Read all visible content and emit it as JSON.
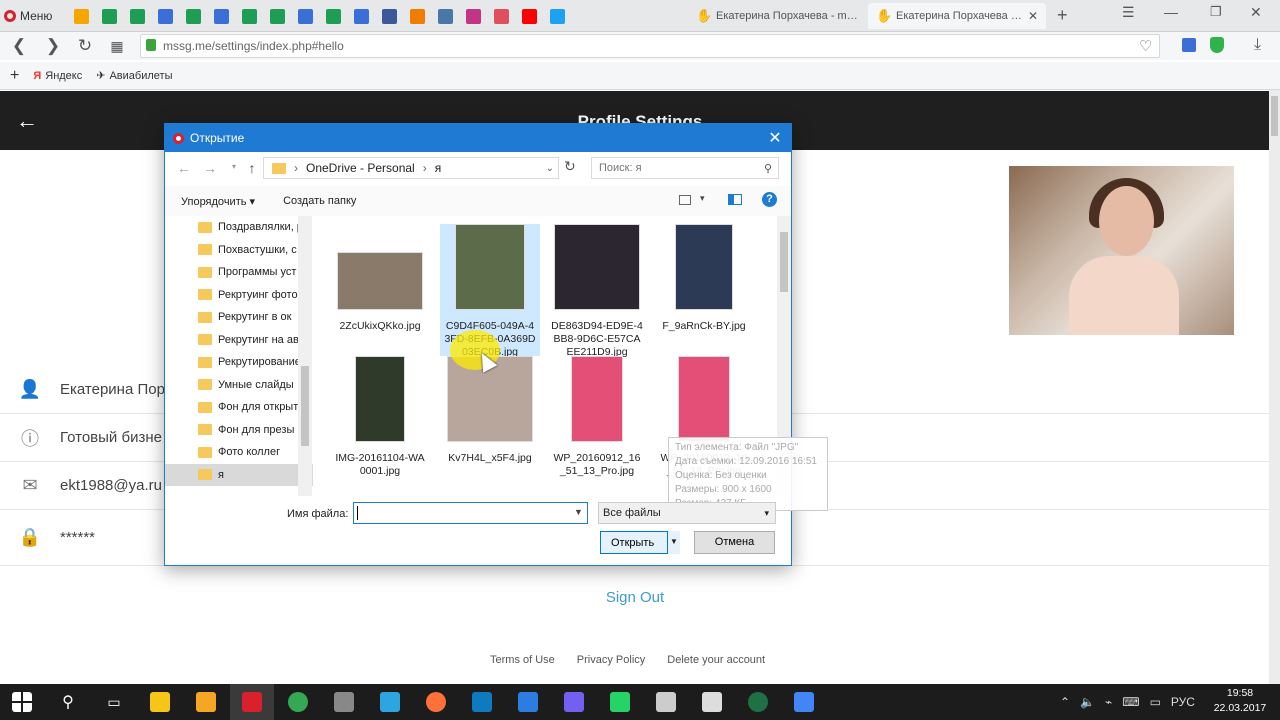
{
  "browser": {
    "menu_label": "Меню",
    "tabs": [
      {
        "label": "Екатерина Порхачева - mssg"
      },
      {
        "label": "Екатерина Порхачева - mssg"
      }
    ],
    "url": "mssg.me/settings/index.php#hello",
    "bookmarks": [
      "Яндекс",
      "Авиабилеты"
    ],
    "pinned_colors": [
      "#f7a600",
      "#1e9e55",
      "#1e9e55",
      "#3b6fd8",
      "#1e9e55",
      "#3b6fd8",
      "#1e9e55",
      "#1e9e55",
      "#3b6fd8",
      "#1e9e55",
      "#3b6fd8",
      "#3b5998",
      "#f07d00",
      "#4a76a8",
      "#c13584",
      "#e04f5f",
      "#ff0000",
      "#1da1f2"
    ]
  },
  "page": {
    "title": "Profile Settings",
    "rows": [
      {
        "icon": "person-icon",
        "text": "Екатерина Пор"
      },
      {
        "icon": "info-icon",
        "text": "Готовый бизне"
      },
      {
        "icon": "mail-icon",
        "text": "ekt1988@ya.ru"
      },
      {
        "icon": "lock-icon",
        "text": "******"
      }
    ],
    "signout": "Sign Out",
    "footer": [
      "Terms of Use",
      "Privacy Policy",
      "Delete your account"
    ]
  },
  "dialog": {
    "title": "Открытие",
    "breadcrumb": [
      "OneDrive - Personal",
      "я"
    ],
    "search_placeholder": "Поиск: я",
    "organize": "Упорядочить",
    "new_folder": "Создать папку",
    "tree": [
      "Поздравлялки, р",
      "Похвастушки, с",
      "Программы уст",
      "Рекртуинг фото",
      "Рекрутинг в ок",
      "Рекрутинг на ав",
      "Рекрутирование",
      "Умные слайды",
      "Фон для открыт",
      "Фон для презы",
      "Фото коллег",
      "я"
    ],
    "files": [
      {
        "name": "2ZcUkixQKko.jpg",
        "color": "#8a7a6a"
      },
      {
        "name": "C9D4F605-049A-43FD-8EFB-0A369D03EC0B.jpg",
        "color": "#5c6b4a"
      },
      {
        "name": "DE863D94-ED9E-4BB8-9D6C-E57CAEE211D9.jpg",
        "color": "#2b2630"
      },
      {
        "name": "F_9aRnCk-BY.jpg",
        "color": "#2d3a55"
      },
      {
        "name": "IMG-20161104-WA0001.jpg",
        "color": "#2f3a2a"
      },
      {
        "name": "Kv7H4L_x5F4.jpg",
        "color": "#b8a59c"
      },
      {
        "name": "WP_20160912_16_51_13_Pro.jpg",
        "color": "#e34f77"
      },
      {
        "name": "WP_20160912_16_51_18_Pro.jpg",
        "color": "#e34f77"
      }
    ],
    "tooltip": [
      "Тип элемента: Файл \"JPG\"",
      "Дата съемки: 12.09.2016 16:51",
      "Оценка: Без оценки",
      "Размеры: 900 x 1600",
      "Размер: 437 КБ"
    ],
    "filename_label": "Имя файла:",
    "filter": "Все файлы",
    "open": "Открыть",
    "cancel": "Отмена"
  },
  "taskbar": {
    "app_colors": [
      "#f5c518",
      "#f5a623",
      "#d8212b",
      "#34a853",
      "#888888",
      "#2ca5e0",
      "#ff7139",
      "#0f7bbf",
      "#2c7de1",
      "#7360f2",
      "#25d366",
      "#cccccc",
      "#dddddd",
      "#1e7145",
      "#4285f4"
    ],
    "lang": "РУС",
    "time": "19:58",
    "date": "22.03.2017"
  }
}
